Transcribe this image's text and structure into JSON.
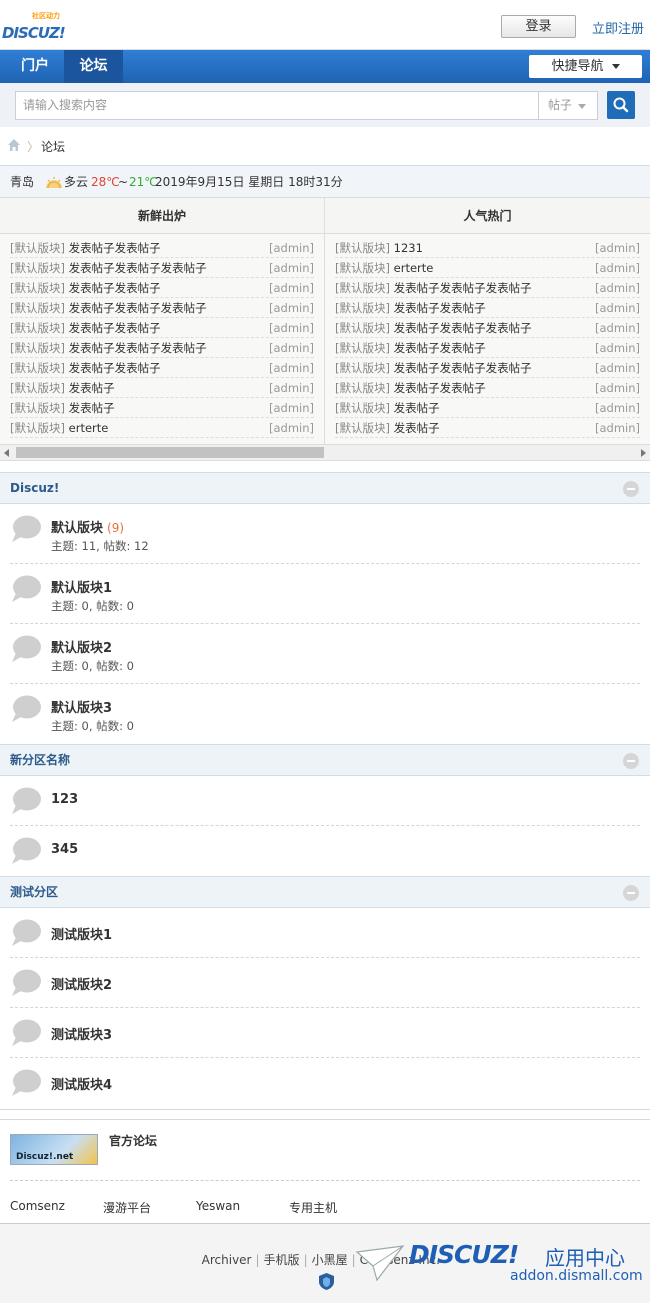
{
  "header": {
    "logo_sub": "社区动力",
    "logo_main": "DISCUZ!",
    "login": "登录",
    "register": "立即注册"
  },
  "nav": {
    "tabs": [
      {
        "label": "门户"
      },
      {
        "label": "论坛"
      }
    ],
    "quick_nav": "快捷导航"
  },
  "search": {
    "placeholder": "请输入搜索内容",
    "type": "帖子"
  },
  "breadcrumb": {
    "current": "论坛"
  },
  "weather": {
    "city": "青岛",
    "condition": "多云",
    "high": "28℃",
    "tilde": "~",
    "low": "21℃",
    "datetime": "2019年9月15日 星期日 18时31分"
  },
  "hot": {
    "left_title": "新鲜出炉",
    "right_title": "人气热门",
    "left": [
      {
        "cat": "[默认版块]",
        "title": "发表帖子发表帖子",
        "author": "[admin]"
      },
      {
        "cat": "[默认版块]",
        "title": "发表帖子发表帖子发表帖子",
        "author": "[admin]"
      },
      {
        "cat": "[默认版块]",
        "title": "发表帖子发表帖子",
        "author": "[admin]"
      },
      {
        "cat": "[默认版块]",
        "title": "发表帖子发表帖子发表帖子",
        "author": "[admin]"
      },
      {
        "cat": "[默认版块]",
        "title": "发表帖子发表帖子",
        "author": "[admin]"
      },
      {
        "cat": "[默认版块]",
        "title": "发表帖子发表帖子发表帖子",
        "author": "[admin]"
      },
      {
        "cat": "[默认版块]",
        "title": "发表帖子发表帖子",
        "author": "[admin]"
      },
      {
        "cat": "[默认版块]",
        "title": "发表帖子",
        "author": "[admin]"
      },
      {
        "cat": "[默认版块]",
        "title": "发表帖子",
        "author": "[admin]"
      },
      {
        "cat": "[默认版块]",
        "title": "erterte",
        "author": "[admin]"
      }
    ],
    "right": [
      {
        "cat": "[默认版块]",
        "title": "1231",
        "author": "[admin]"
      },
      {
        "cat": "[默认版块]",
        "title": "erterte",
        "author": "[admin]"
      },
      {
        "cat": "[默认版块]",
        "title": "发表帖子发表帖子发表帖子",
        "author": "[admin]"
      },
      {
        "cat": "[默认版块]",
        "title": "发表帖子发表帖子",
        "author": "[admin]"
      },
      {
        "cat": "[默认版块]",
        "title": "发表帖子发表帖子发表帖子",
        "author": "[admin]"
      },
      {
        "cat": "[默认版块]",
        "title": "发表帖子发表帖子",
        "author": "[admin]"
      },
      {
        "cat": "[默认版块]",
        "title": "发表帖子发表帖子发表帖子",
        "author": "[admin]"
      },
      {
        "cat": "[默认版块]",
        "title": "发表帖子发表帖子",
        "author": "[admin]"
      },
      {
        "cat": "[默认版块]",
        "title": "发表帖子",
        "author": "[admin]"
      },
      {
        "cat": "[默认版块]",
        "title": "发表帖子",
        "author": "[admin]"
      }
    ]
  },
  "sections": [
    {
      "title": "Discuz!",
      "forums": [
        {
          "name": "默认版块",
          "count": "(9)",
          "stats": "主题: 11, 帖数: 12"
        },
        {
          "name": "默认版块1",
          "count": "",
          "stats": "主题: 0, 帖数: 0"
        },
        {
          "name": "默认版块2",
          "count": "",
          "stats": "主题: 0, 帖数: 0"
        },
        {
          "name": "默认版块3",
          "count": "",
          "stats": "主题: 0, 帖数: 0"
        }
      ]
    },
    {
      "title": "新分区名称",
      "forums": [
        {
          "name": "123"
        },
        {
          "name": "345"
        }
      ]
    },
    {
      "title": "测试分区",
      "forums": [
        {
          "name": "测试版块1"
        },
        {
          "name": "测试版块2"
        },
        {
          "name": "测试版块3"
        },
        {
          "name": "测试版块4"
        }
      ]
    }
  ],
  "links": {
    "banner_text": "Discuz!.net",
    "official": "官方论坛",
    "friends": [
      "Comsenz",
      "漫游平台",
      "Yeswan",
      "专用主机"
    ]
  },
  "footer": {
    "links": [
      "Archiver",
      "手机版",
      "小黑屋",
      "Comsenz Inc."
    ],
    "watermark_brand": "DISCUZ!",
    "watermark_cn": "应用中心",
    "watermark_url": "addon.dismall.com"
  }
}
